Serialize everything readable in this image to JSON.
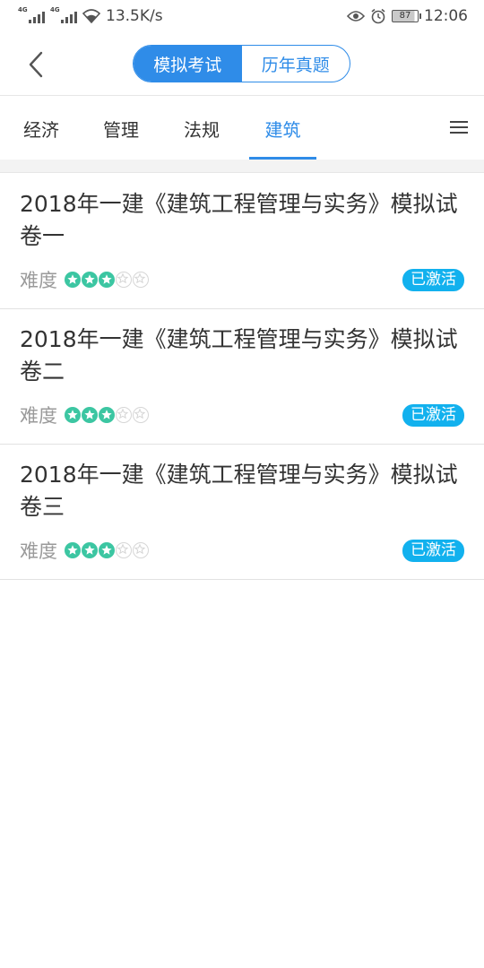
{
  "status_bar": {
    "signal1_tag": "4G",
    "signal2_tag": "4G",
    "net_speed": "13.5K/s",
    "battery": "87",
    "time": "12:06"
  },
  "header": {
    "segments": [
      {
        "label": "模拟考试",
        "active": true
      },
      {
        "label": "历年真题",
        "active": false
      }
    ]
  },
  "tabs": [
    {
      "label": "经济",
      "active": false
    },
    {
      "label": "管理",
      "active": false
    },
    {
      "label": "法规",
      "active": false
    },
    {
      "label": "建筑",
      "active": true
    }
  ],
  "colors": {
    "accent": "#2f8ce8",
    "star_filled": "#3cc6a2",
    "badge": "#12b1ee"
  },
  "exams": [
    {
      "title": "2018年一建《建筑工程管理与实务》模拟试卷一",
      "difficulty_label": "难度",
      "difficulty": 3,
      "difficulty_max": 5,
      "status": "已激活"
    },
    {
      "title": "2018年一建《建筑工程管理与实务》模拟试卷二",
      "difficulty_label": "难度",
      "difficulty": 3,
      "difficulty_max": 5,
      "status": "已激活"
    },
    {
      "title": "2018年一建《建筑工程管理与实务》模拟试卷三",
      "difficulty_label": "难度",
      "difficulty": 3,
      "difficulty_max": 5,
      "status": "已激活"
    }
  ]
}
